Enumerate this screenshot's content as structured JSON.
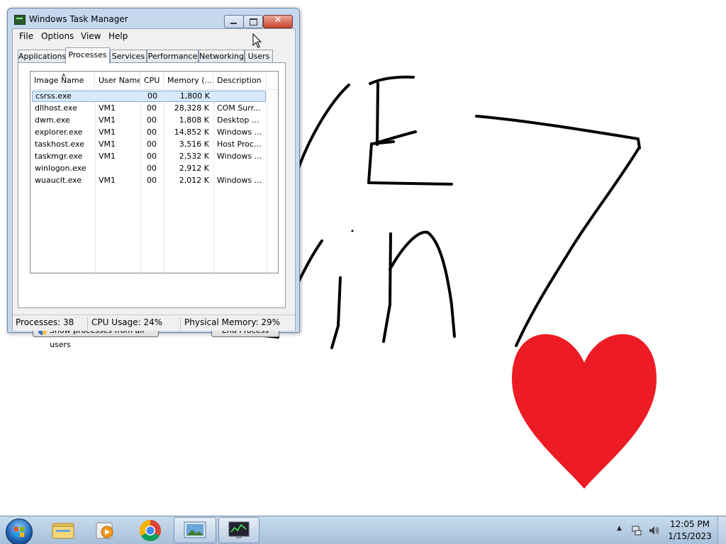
{
  "window": {
    "title": "Windows Task Manager",
    "close_glyph": "✕"
  },
  "menu": [
    "File",
    "Options",
    "View",
    "Help"
  ],
  "tabs": [
    {
      "label": "Applications"
    },
    {
      "label": "Processes",
      "active": true
    },
    {
      "label": "Services"
    },
    {
      "label": "Performance"
    },
    {
      "label": "Networking"
    },
    {
      "label": "Users"
    }
  ],
  "columns": [
    "Image Name",
    "User Name",
    "CPU",
    "Memory (...",
    "Description"
  ],
  "processes": [
    {
      "name": "csrss.exe",
      "user": "",
      "cpu": "00",
      "memory": "1,800 K",
      "description": "",
      "selected": true
    },
    {
      "name": "dllhost.exe",
      "user": "VM1",
      "cpu": "00",
      "memory": "28,328 K",
      "description": "COM Surr..."
    },
    {
      "name": "dwm.exe",
      "user": "VM1",
      "cpu": "00",
      "memory": "1,808 K",
      "description": "Desktop ..."
    },
    {
      "name": "explorer.exe",
      "user": "VM1",
      "cpu": "00",
      "memory": "14,852 K",
      "description": "Windows ..."
    },
    {
      "name": "taskhost.exe",
      "user": "VM1",
      "cpu": "00",
      "memory": "3,516 K",
      "description": "Host Proc..."
    },
    {
      "name": "taskmgr.exe",
      "user": "VM1",
      "cpu": "00",
      "memory": "2,532 K",
      "description": "Windows ..."
    },
    {
      "name": "winlogon.exe",
      "user": "",
      "cpu": "00",
      "memory": "2,912 K",
      "description": ""
    },
    {
      "name": "wuauclt.exe",
      "user": "VM1",
      "cpu": "00",
      "memory": "2,012 K",
      "description": "Windows ..."
    }
  ],
  "buttons": {
    "show_all": "Show processes from all users",
    "end_process": "End Process"
  },
  "status": {
    "processes": "Processes: 38",
    "cpu": "CPU Usage: 24%",
    "memory": "Physical Memory: 29%"
  },
  "taskbar": {
    "items": [
      "windows-explorer-icon",
      "media-player-icon",
      "chrome-icon",
      "photo-viewer-icon",
      "task-manager-icon"
    ],
    "time": "12:05 PM",
    "date": "1/15/2023"
  },
  "colors": {
    "heart": "#ed1c24",
    "ink": "#000000"
  }
}
